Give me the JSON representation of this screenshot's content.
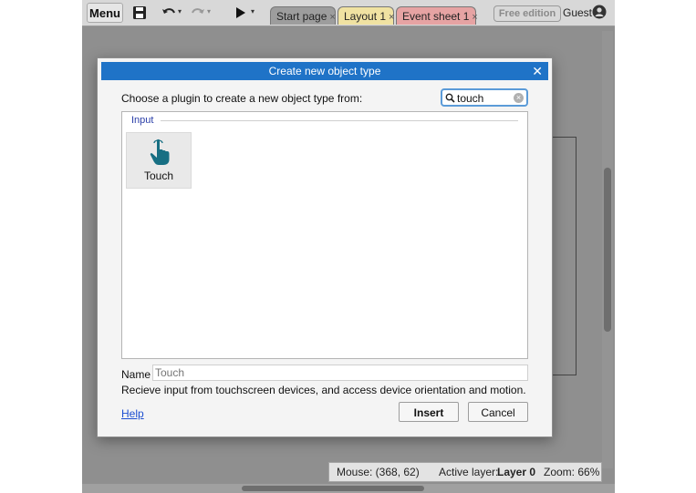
{
  "toolbar": {
    "menu_label": "Menu",
    "tabs": [
      {
        "label": "Start page"
      },
      {
        "label": "Layout 1"
      },
      {
        "label": "Event sheet 1"
      }
    ],
    "tab_close_glyph": "×",
    "free_edition_label": "Free edition",
    "user_label": "Guest",
    "icons": [
      "save-icon",
      "undo-icon",
      "redo-icon",
      "play-icon",
      "user-icon"
    ]
  },
  "status_bar": {
    "mouse_label": "Mouse: (368, 62)",
    "active_layer_prefix": "Active layer:",
    "active_layer_value": "Layer 0",
    "zoom_label": "Zoom: 66%"
  },
  "dialog": {
    "title": "Create new object type",
    "close_glyph": "✕",
    "prompt": "Choose a plugin to create a new object type from:",
    "search_value": "touch",
    "group_label": "Input",
    "plugins": [
      {
        "label": "Touch",
        "icon": "touch-hand-icon"
      }
    ],
    "name_label": "Name",
    "name_placeholder": "Touch",
    "description": "Recieve input from touchscreen devices, and access device orientation and motion.",
    "help_label": "Help",
    "insert_label": "Insert",
    "cancel_label": "Cancel",
    "accent_color": "#1f73c7"
  }
}
